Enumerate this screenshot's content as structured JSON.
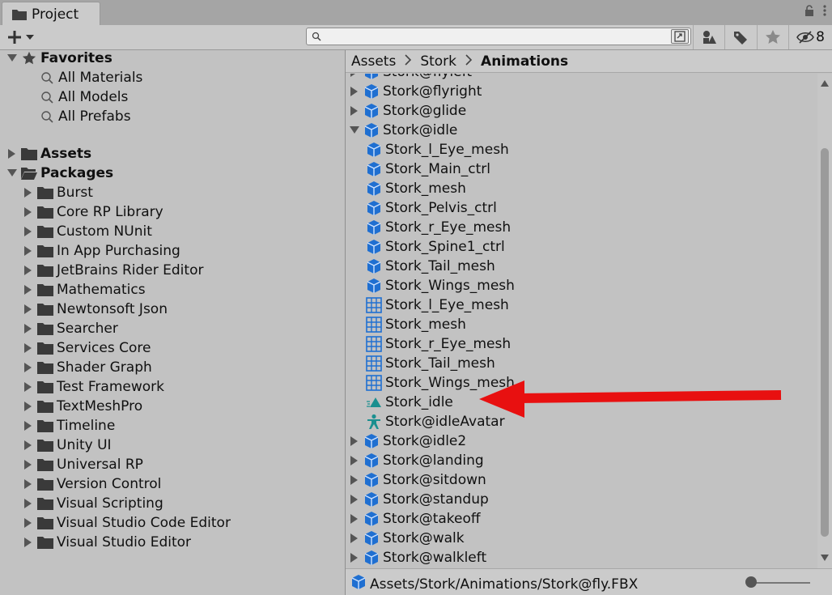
{
  "tab": {
    "title": "Project"
  },
  "toolbar": {
    "hidden_count": "8",
    "search": {
      "value": "",
      "placeholder": ""
    }
  },
  "left": {
    "favorites": {
      "label": "Favorites",
      "items": [
        "All Materials",
        "All Models",
        "All Prefabs"
      ]
    },
    "assets_label": "Assets",
    "packages": {
      "label": "Packages",
      "items": [
        "Burst",
        "Core RP Library",
        "Custom NUnit",
        "In App Purchasing",
        "JetBrains Rider Editor",
        "Mathematics",
        "Newtonsoft Json",
        "Searcher",
        "Services Core",
        "Shader Graph",
        "Test Framework",
        "TextMeshPro",
        "Timeline",
        "Unity UI",
        "Universal RP",
        "Version Control",
        "Visual Scripting",
        "Visual Studio Code Editor",
        "Visual Studio Editor"
      ]
    }
  },
  "breadcrumb": [
    "Assets",
    "Stork",
    "Animations"
  ],
  "list": [
    {
      "label": "Stork@flyleft",
      "icon": "model-icon",
      "level": 0,
      "arrow": "right",
      "partial": true
    },
    {
      "label": "Stork@flyright",
      "icon": "model-icon",
      "level": 0,
      "arrow": "right"
    },
    {
      "label": "Stork@glide",
      "icon": "model-icon",
      "level": 0,
      "arrow": "right"
    },
    {
      "label": "Stork@idle",
      "icon": "model-icon",
      "level": 0,
      "arrow": "down"
    },
    {
      "label": "Stork_l_Eye_mesh",
      "icon": "model-icon",
      "level": 1
    },
    {
      "label": "Stork_Main_ctrl",
      "icon": "model-icon",
      "level": 1
    },
    {
      "label": "Stork_mesh",
      "icon": "model-icon",
      "level": 1
    },
    {
      "label": "Stork_Pelvis_ctrl",
      "icon": "model-icon",
      "level": 1
    },
    {
      "label": "Stork_r_Eye_mesh",
      "icon": "model-icon",
      "level": 1
    },
    {
      "label": "Stork_Spine1_ctrl",
      "icon": "model-icon",
      "level": 1
    },
    {
      "label": "Stork_Tail_mesh",
      "icon": "model-icon",
      "level": 1
    },
    {
      "label": "Stork_Wings_mesh",
      "icon": "model-icon",
      "level": 1
    },
    {
      "label": "Stork_l_Eye_mesh",
      "icon": "mesh-icon",
      "level": 1
    },
    {
      "label": "Stork_mesh",
      "icon": "mesh-icon",
      "level": 1
    },
    {
      "label": "Stork_r_Eye_mesh",
      "icon": "mesh-icon",
      "level": 1
    },
    {
      "label": "Stork_Tail_mesh",
      "icon": "mesh-icon",
      "level": 1
    },
    {
      "label": "Stork_Wings_mesh",
      "icon": "mesh-icon",
      "level": 1
    },
    {
      "label": "Stork_idle",
      "icon": "animation-clip-icon",
      "level": 1
    },
    {
      "label": "Stork@idleAvatar",
      "icon": "avatar-icon",
      "level": 1
    },
    {
      "label": "Stork@idle2",
      "icon": "model-icon",
      "level": 0,
      "arrow": "right"
    },
    {
      "label": "Stork@landing",
      "icon": "model-icon",
      "level": 0,
      "arrow": "right"
    },
    {
      "label": "Stork@sitdown",
      "icon": "model-icon",
      "level": 0,
      "arrow": "right"
    },
    {
      "label": "Stork@standup",
      "icon": "model-icon",
      "level": 0,
      "arrow": "right"
    },
    {
      "label": "Stork@takeoff",
      "icon": "model-icon",
      "level": 0,
      "arrow": "right"
    },
    {
      "label": "Stork@walk",
      "icon": "model-icon",
      "level": 0,
      "arrow": "right"
    },
    {
      "label": "Stork@walkleft",
      "icon": "model-icon",
      "level": 0,
      "arrow": "right"
    }
  ],
  "status": {
    "path": "Assets/Stork/Animations/Stork@fly.FBX"
  },
  "colors": {
    "annotation_arrow": "#e81010",
    "accent_blue": "#1f6fd1",
    "teal": "#1a8f8f"
  }
}
